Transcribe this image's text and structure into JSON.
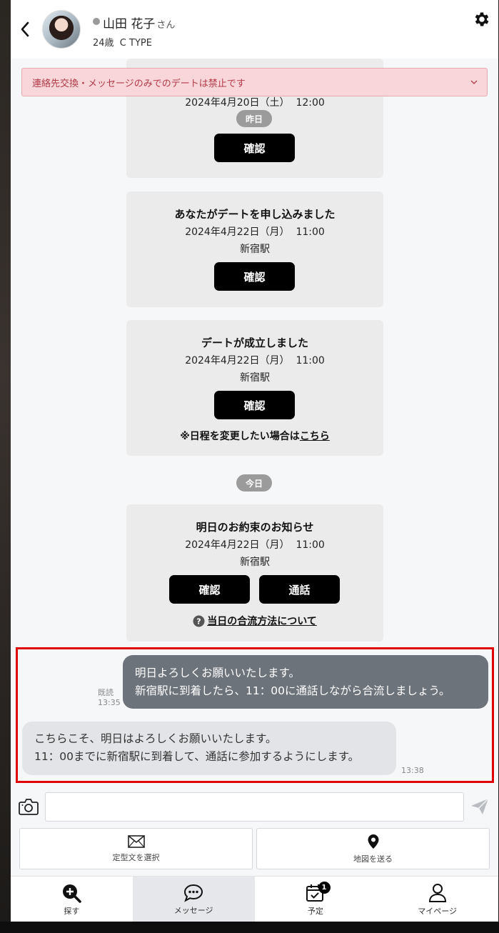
{
  "header": {
    "name": "山田 花子",
    "honorific": "さん",
    "meta": "24歳  C TYPE"
  },
  "warning": {
    "text": "連絡先交換・メッセージのみでのデートは禁止です"
  },
  "cards": [
    {
      "datetime": "2024年4月20日（土）  12:00",
      "confirm_label": "確認"
    },
    {
      "title": "あなたがデートを申し込みました",
      "datetime": "2024年4月22日（月）  11:00",
      "place": "新宿駅",
      "confirm_label": "確認"
    },
    {
      "title": "デートが成立しました",
      "datetime": "2024年4月22日（月）  11:00",
      "place": "新宿駅",
      "confirm_label": "確認",
      "note_prefix": "※日程を変更したい場合は",
      "note_link": "こちら"
    },
    {
      "title": "明日のお約束のお知らせ",
      "datetime": "2024年4月22日（月）  11:00",
      "place": "新宿駅",
      "confirm_label": "確認",
      "call_label": "通話",
      "help_link": "当日の合流方法について"
    }
  ],
  "day_labels": {
    "yesterday": "昨日",
    "today": "今日"
  },
  "messages": [
    {
      "from": "me",
      "lines": [
        "明日よろしくお願いいたします。",
        "新宿駅に到着したら、11：00に通話しながら合流しましょう。"
      ],
      "read": "既読",
      "time": "13:35"
    },
    {
      "from": "them",
      "lines": [
        "こちらこそ、明日はよろしくお願いいたします。",
        "11：00までに新宿駅に到着して、通話に参加するようにします。"
      ],
      "time": "13:38"
    }
  ],
  "input": {
    "placeholder": "",
    "value": ""
  },
  "actions": {
    "template_label": "定型文を選択",
    "map_label": "地図を送る"
  },
  "nav": {
    "items": [
      {
        "label": "探す",
        "icon": "search-plus-icon"
      },
      {
        "label": "メッセージ",
        "icon": "chat-icon",
        "active": true
      },
      {
        "label": "予定",
        "icon": "calendar-check-icon",
        "badge": "1"
      },
      {
        "label": "マイページ",
        "icon": "person-icon"
      }
    ]
  },
  "colors": {
    "warning_bg": "#f8d6da",
    "warning_text": "#b23a48",
    "my_bubble": "#6d737b",
    "their_bubble": "#e3e4e7",
    "highlight": "#e00000"
  }
}
